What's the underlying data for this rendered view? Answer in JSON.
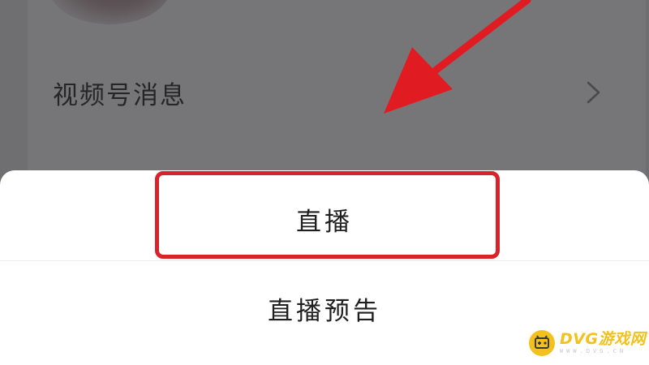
{
  "background_list": {
    "row_label": "视频号消息",
    "chevron_icon": "chevron-right-icon"
  },
  "action_sheet": {
    "options": [
      {
        "label": "直播",
        "highlighted": true
      },
      {
        "label": "直播预告",
        "highlighted": false
      }
    ]
  },
  "annotation": {
    "arrow_icon": "red-arrow-icon",
    "highlight_color": "#d8232a"
  },
  "watermark": {
    "brand": "DVG游戏网",
    "url": "WWW.DVG.CN",
    "logo_icon": "gamepad-logo-icon",
    "color": "#f2c11d"
  }
}
